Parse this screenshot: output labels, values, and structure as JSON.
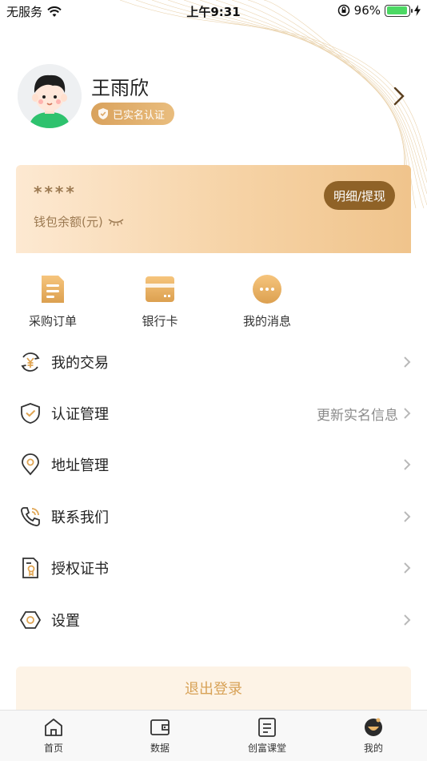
{
  "status_bar": {
    "carrier": "无服务",
    "time": "上午9:31",
    "battery_percent": "96%",
    "battery_level": 0.96
  },
  "profile": {
    "name": "王雨欣",
    "badge": "已实名认证"
  },
  "wallet": {
    "masked_balance": "****",
    "label": "钱包余额(元)",
    "detail_button": "明细/提现"
  },
  "quick_actions": [
    {
      "label": "采购订单",
      "icon": "document-icon"
    },
    {
      "label": "银行卡",
      "icon": "bank-card-icon"
    },
    {
      "label": "我的消息",
      "icon": "message-icon"
    }
  ],
  "menu": [
    {
      "label": "我的交易",
      "icon": "yuan-exchange-icon",
      "extra": ""
    },
    {
      "label": "认证管理",
      "icon": "shield-check-icon",
      "extra": "更新实名信息"
    },
    {
      "label": "地址管理",
      "icon": "location-pin-icon",
      "extra": ""
    },
    {
      "label": "联系我们",
      "icon": "phone-icon",
      "extra": ""
    },
    {
      "label": "授权证书",
      "icon": "certificate-icon",
      "extra": ""
    },
    {
      "label": "设置",
      "icon": "hexagon-settings-icon",
      "extra": ""
    }
  ],
  "logout_label": "退出登录",
  "tabs": [
    {
      "label": "首页",
      "icon": "home-icon"
    },
    {
      "label": "数据",
      "icon": "wallet-icon"
    },
    {
      "label": "创富课堂",
      "icon": "book-icon"
    },
    {
      "label": "我的",
      "icon": "profile-face-icon"
    }
  ],
  "colors": {
    "accent": "#d8a257",
    "detail_button": "#8f6227",
    "battery": "#4cd964"
  }
}
